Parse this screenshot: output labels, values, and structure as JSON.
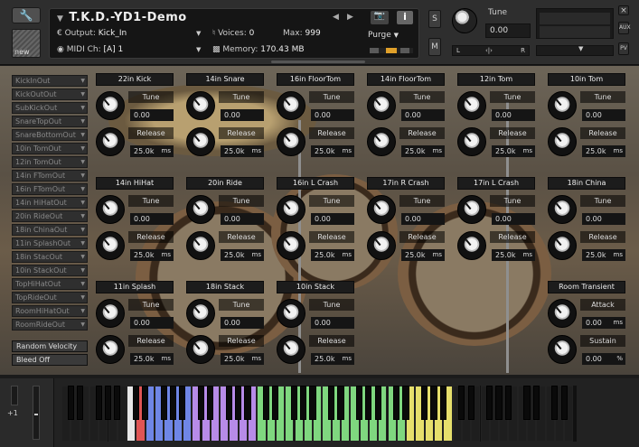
{
  "header": {
    "instrument_name": "T.K.D.-YD1-Demo",
    "output_label": "Output:",
    "output_value": "Kick_In",
    "voices_label": "Voices:",
    "voices_value": "0",
    "max_label": "Max:",
    "max_value": "999",
    "midi_label": "MIDI Ch:",
    "midi_value": "[A]  1",
    "memory_label": "Memory:",
    "memory_value": "170.43 MB",
    "purge_label": "Purge",
    "new_label": "new",
    "s_label": "S",
    "m_label": "M",
    "info_label": "i",
    "tune_label": "Tune",
    "tune_value": "0.00",
    "pan_left": "L",
    "pan_center": "‹|›",
    "pan_right": "R",
    "side_x": "×",
    "side_aux": "AUX",
    "side_pv": "PV"
  },
  "routing": [
    "KickInOut",
    "KickOutOut",
    "SubKickOut",
    "SnareTopOut",
    "SnareBottomOut",
    "10in TomOut",
    "12in TomOut",
    "14in FTomOut",
    "16in FTomOut",
    "14in HiHatOut",
    "20in RideOut",
    "18in ChinaOut",
    "11in SplashOut",
    "18in StacOut",
    "10in StackOut",
    "TopHiHatOut",
    "TopRideOut",
    "RoomHiHatOut",
    "RoomRideOut"
  ],
  "buttons": {
    "random_velocity": "Random Velocity",
    "bleed": "Bleed Off"
  },
  "modules": [
    {
      "title": "22in Kick",
      "p1": "Tune",
      "v1": "0.00",
      "p2": "Release",
      "v2": "25.0k",
      "u2": "ms"
    },
    {
      "title": "14in Snare",
      "p1": "Tune",
      "v1": "0.00",
      "p2": "Release",
      "v2": "25.0k",
      "u2": "ms"
    },
    {
      "title": "16in FloorTom",
      "p1": "Tune",
      "v1": "0.00",
      "p2": "Release",
      "v2": "25.0k",
      "u2": "ms"
    },
    {
      "title": "14in FloorTom",
      "p1": "Tune",
      "v1": "0.00",
      "p2": "Release",
      "v2": "25.0k",
      "u2": "ms"
    },
    {
      "title": "12in Tom",
      "p1": "Tune",
      "v1": "0.00",
      "p2": "Release",
      "v2": "25.0k",
      "u2": "ms"
    },
    {
      "title": "10in Tom",
      "p1": "Tune",
      "v1": "0.00",
      "p2": "Release",
      "v2": "25.0k",
      "u2": "ms"
    },
    {
      "title": "14in HiHat",
      "p1": "Tune",
      "v1": "0.00",
      "p2": "Release",
      "v2": "25.0k",
      "u2": "ms"
    },
    {
      "title": "20in Ride",
      "p1": "Tune",
      "v1": "0.00",
      "p2": "Release",
      "v2": "25.0k",
      "u2": "ms"
    },
    {
      "title": "16in L Crash",
      "p1": "Tune",
      "v1": "0.00",
      "p2": "Release",
      "v2": "25.0k",
      "u2": "ms"
    },
    {
      "title": "17in R Crash",
      "p1": "Tune",
      "v1": "0.00",
      "p2": "Release",
      "v2": "25.0k",
      "u2": "ms"
    },
    {
      "title": "17in L Crash",
      "p1": "Tune",
      "v1": "0.00",
      "p2": "Release",
      "v2": "25.0k",
      "u2": "ms"
    },
    {
      "title": "18in China",
      "p1": "Tune",
      "v1": "0.00",
      "p2": "Release",
      "v2": "25.0k",
      "u2": "ms"
    },
    {
      "title": "11in Splash",
      "p1": "Tune",
      "v1": "0.00",
      "p2": "Release",
      "v2": "25.0k",
      "u2": "ms"
    },
    {
      "title": "18in Stack",
      "p1": "Tune",
      "v1": "0.00",
      "p2": "Release",
      "v2": "25.0k",
      "u2": "ms"
    },
    {
      "title": "10in Stack",
      "p1": "Tune",
      "v1": "0.00",
      "p2": "Release",
      "v2": "25.0k",
      "u2": "ms"
    },
    {
      "title": "Room Transient",
      "p1": "Attack",
      "v1": "0.00",
      "u1": "ms",
      "p2": "Sustain",
      "v2": "0.00",
      "u2": "%"
    }
  ],
  "keyboard": {
    "octave_label": "+1",
    "colors": {
      "red": "#e05555",
      "blue": "#6f86e6",
      "violet": "#b78be8",
      "green": "#7fd77f",
      "yellow": "#e6df6c",
      "white": "#e8e8e8"
    }
  }
}
